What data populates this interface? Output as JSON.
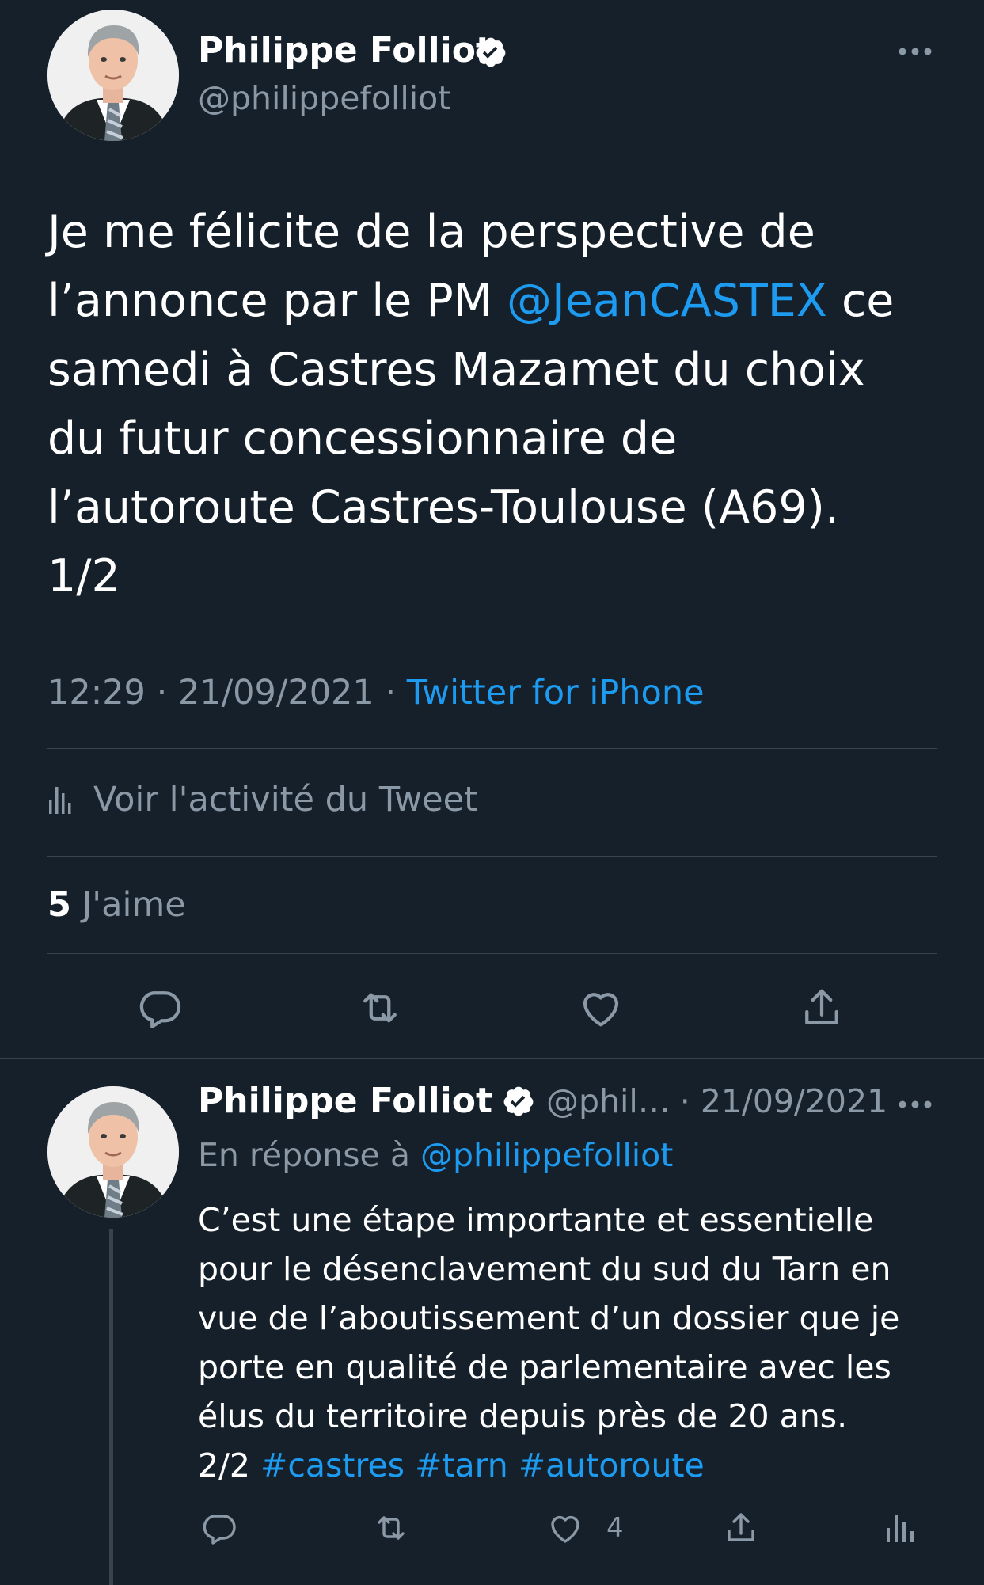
{
  "tweet": {
    "author_name": "Philippe Folliot",
    "author_handle": "@philippefolliot",
    "text_lines": [
      "Je me félicite de la perspective de",
      "l’annonce par le PM ",
      "samedi à Castres Mazamet du choix",
      "du futur concessionnaire de",
      "l’autoroute Castres-Toulouse (A69).",
      "1/2"
    ],
    "mention": "@JeanCASTEX",
    "mention_suffix": " ce",
    "time": "12:29",
    "date": "21/09/2021",
    "separator": " · ",
    "source": "Twitter for iPhone",
    "activity_label": "Voir l'activité du Tweet",
    "likes_count": "5",
    "likes_label": " J'aime"
  },
  "reply": {
    "author_name": "Philippe Folliot",
    "author_handle": "@phil…",
    "date": " · 21/09/2021",
    "reply_prefix": "En réponse à ",
    "reply_to": "@philippefolliot",
    "text_lines": [
      "C’est une étape importante et essentielle",
      "pour le désenclavement du sud du Tarn en",
      "vue de l’aboutissement d’un dossier que je",
      "porte en qualité de parlementaire avec les",
      "élus du territoire depuis près de 20 ans."
    ],
    "last_line_prefix": "2/2 ",
    "hashtags": [
      "#castres",
      "#tarn",
      "#autoroute"
    ],
    "likes_count": "4"
  },
  "icons": {
    "verified": "verified-badge-icon",
    "more": "more-icon",
    "activity": "activity-chart-icon",
    "reply": "reply-icon",
    "retweet": "retweet-icon",
    "like": "like-icon",
    "share": "share-icon",
    "analytics": "analytics-icon"
  },
  "colors": {
    "background": "#15202b",
    "text": "#ffffff",
    "secondary": "#8b98a5",
    "link": "#1d9bf0",
    "divider": "#38444d"
  }
}
